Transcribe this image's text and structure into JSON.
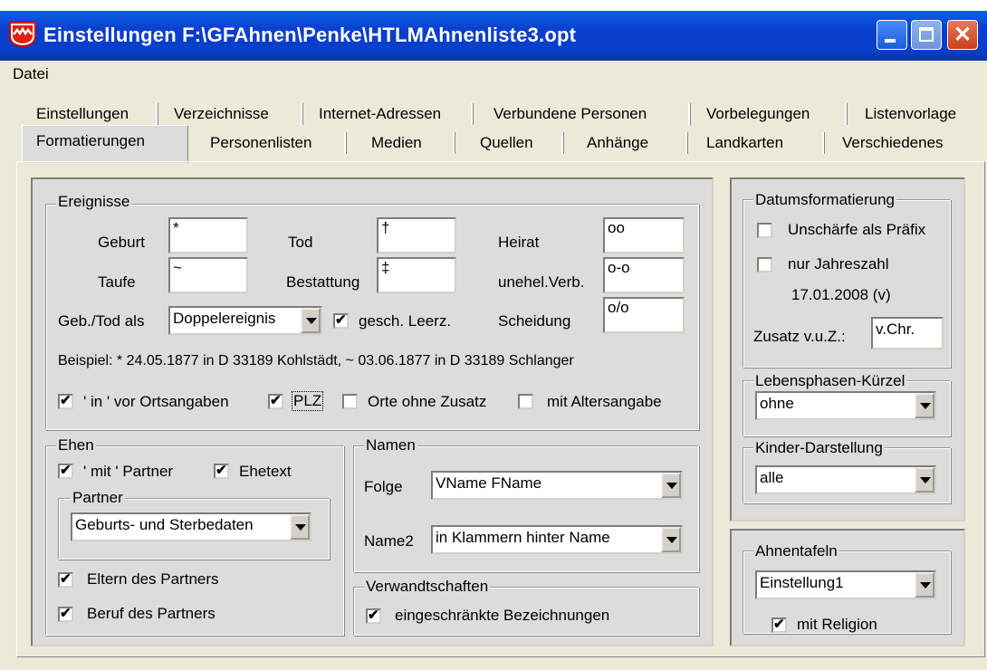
{
  "window": {
    "title": "Einstellungen  F:\\GFAhnen\\Penke\\HTLMAhnenliste3.opt",
    "close_glyph": "✕"
  },
  "menu": {
    "datei": "Datei"
  },
  "tabs_row1": [
    "Einstellungen",
    "Verzeichnisse",
    "Internet-Adressen",
    "Verbundene Personen",
    "Vorbelegungen",
    "Listenvorlage"
  ],
  "tabs_row2": [
    "Formatierungen",
    "Personenlisten",
    "Medien",
    "Quellen",
    "Anhänge",
    "Landkarten",
    "Verschiedenes"
  ],
  "ereignisse": {
    "title": "Ereignisse",
    "geburt_label": "Geburt",
    "geburt_value": "*",
    "tod_label": "Tod",
    "tod_value": "†",
    "heirat_label": "Heirat",
    "heirat_value": "oo",
    "taufe_label": "Taufe",
    "taufe_value": "~",
    "bestattung_label": "Bestattung",
    "bestattung_value": "‡",
    "unehel_label": "unehel.Verb.",
    "unehel_value": "o-o",
    "gebtod_label": "Geb./Tod als",
    "gebtod_value": "Doppelereignis",
    "leerz_label": "gesch. Leerz.",
    "scheidung_label": "Scheidung",
    "scheidung_value": "o/o",
    "beispiel": "Beispiel:  * 24.05.1877 in D 33189 Kohlstädt, ~ 03.06.1877 in D 33189 Schlanger",
    "in_label": "' in ' vor Ortsangaben",
    "plz_label": "PLZ",
    "orte_label": "Orte ohne Zusatz",
    "alter_label": "mit Altersangabe"
  },
  "ehen": {
    "title": "Ehen",
    "mit_partner_label": "' mit ' Partner",
    "ehetext_label": "Ehetext",
    "partner_title": "Partner",
    "partner_value": "Geburts- und Sterbedaten",
    "eltern_label": "Eltern des Partners",
    "beruf_label": "Beruf des Partners"
  },
  "namen": {
    "title": "Namen",
    "folge_label": "Folge",
    "folge_value": "VName FName",
    "name2_label": "Name2",
    "name2_value": "in Klammern hinter Name"
  },
  "verwandt": {
    "title": "Verwandtschaften",
    "eingeschr_label": "eingeschränkte Bezeichnungen"
  },
  "datum": {
    "title": "Datumsformatierung",
    "unschaerfe_label": "Unschärfe als Präfix",
    "jahreszahl_label": "nur Jahreszahl",
    "beispiel": "17.01.2008 (v)",
    "zusatz_label": "Zusatz v.u.Z.:",
    "zusatz_value": "v.Chr."
  },
  "lebensphasen": {
    "title": "Lebensphasen-Kürzel",
    "value": "ohne"
  },
  "kinder": {
    "title": "Kinder-Darstellung",
    "value": "alle"
  },
  "ahnentafeln": {
    "title": "Ahnentafeln",
    "value": "Einstellung1",
    "religion_label": "mit Religion"
  }
}
